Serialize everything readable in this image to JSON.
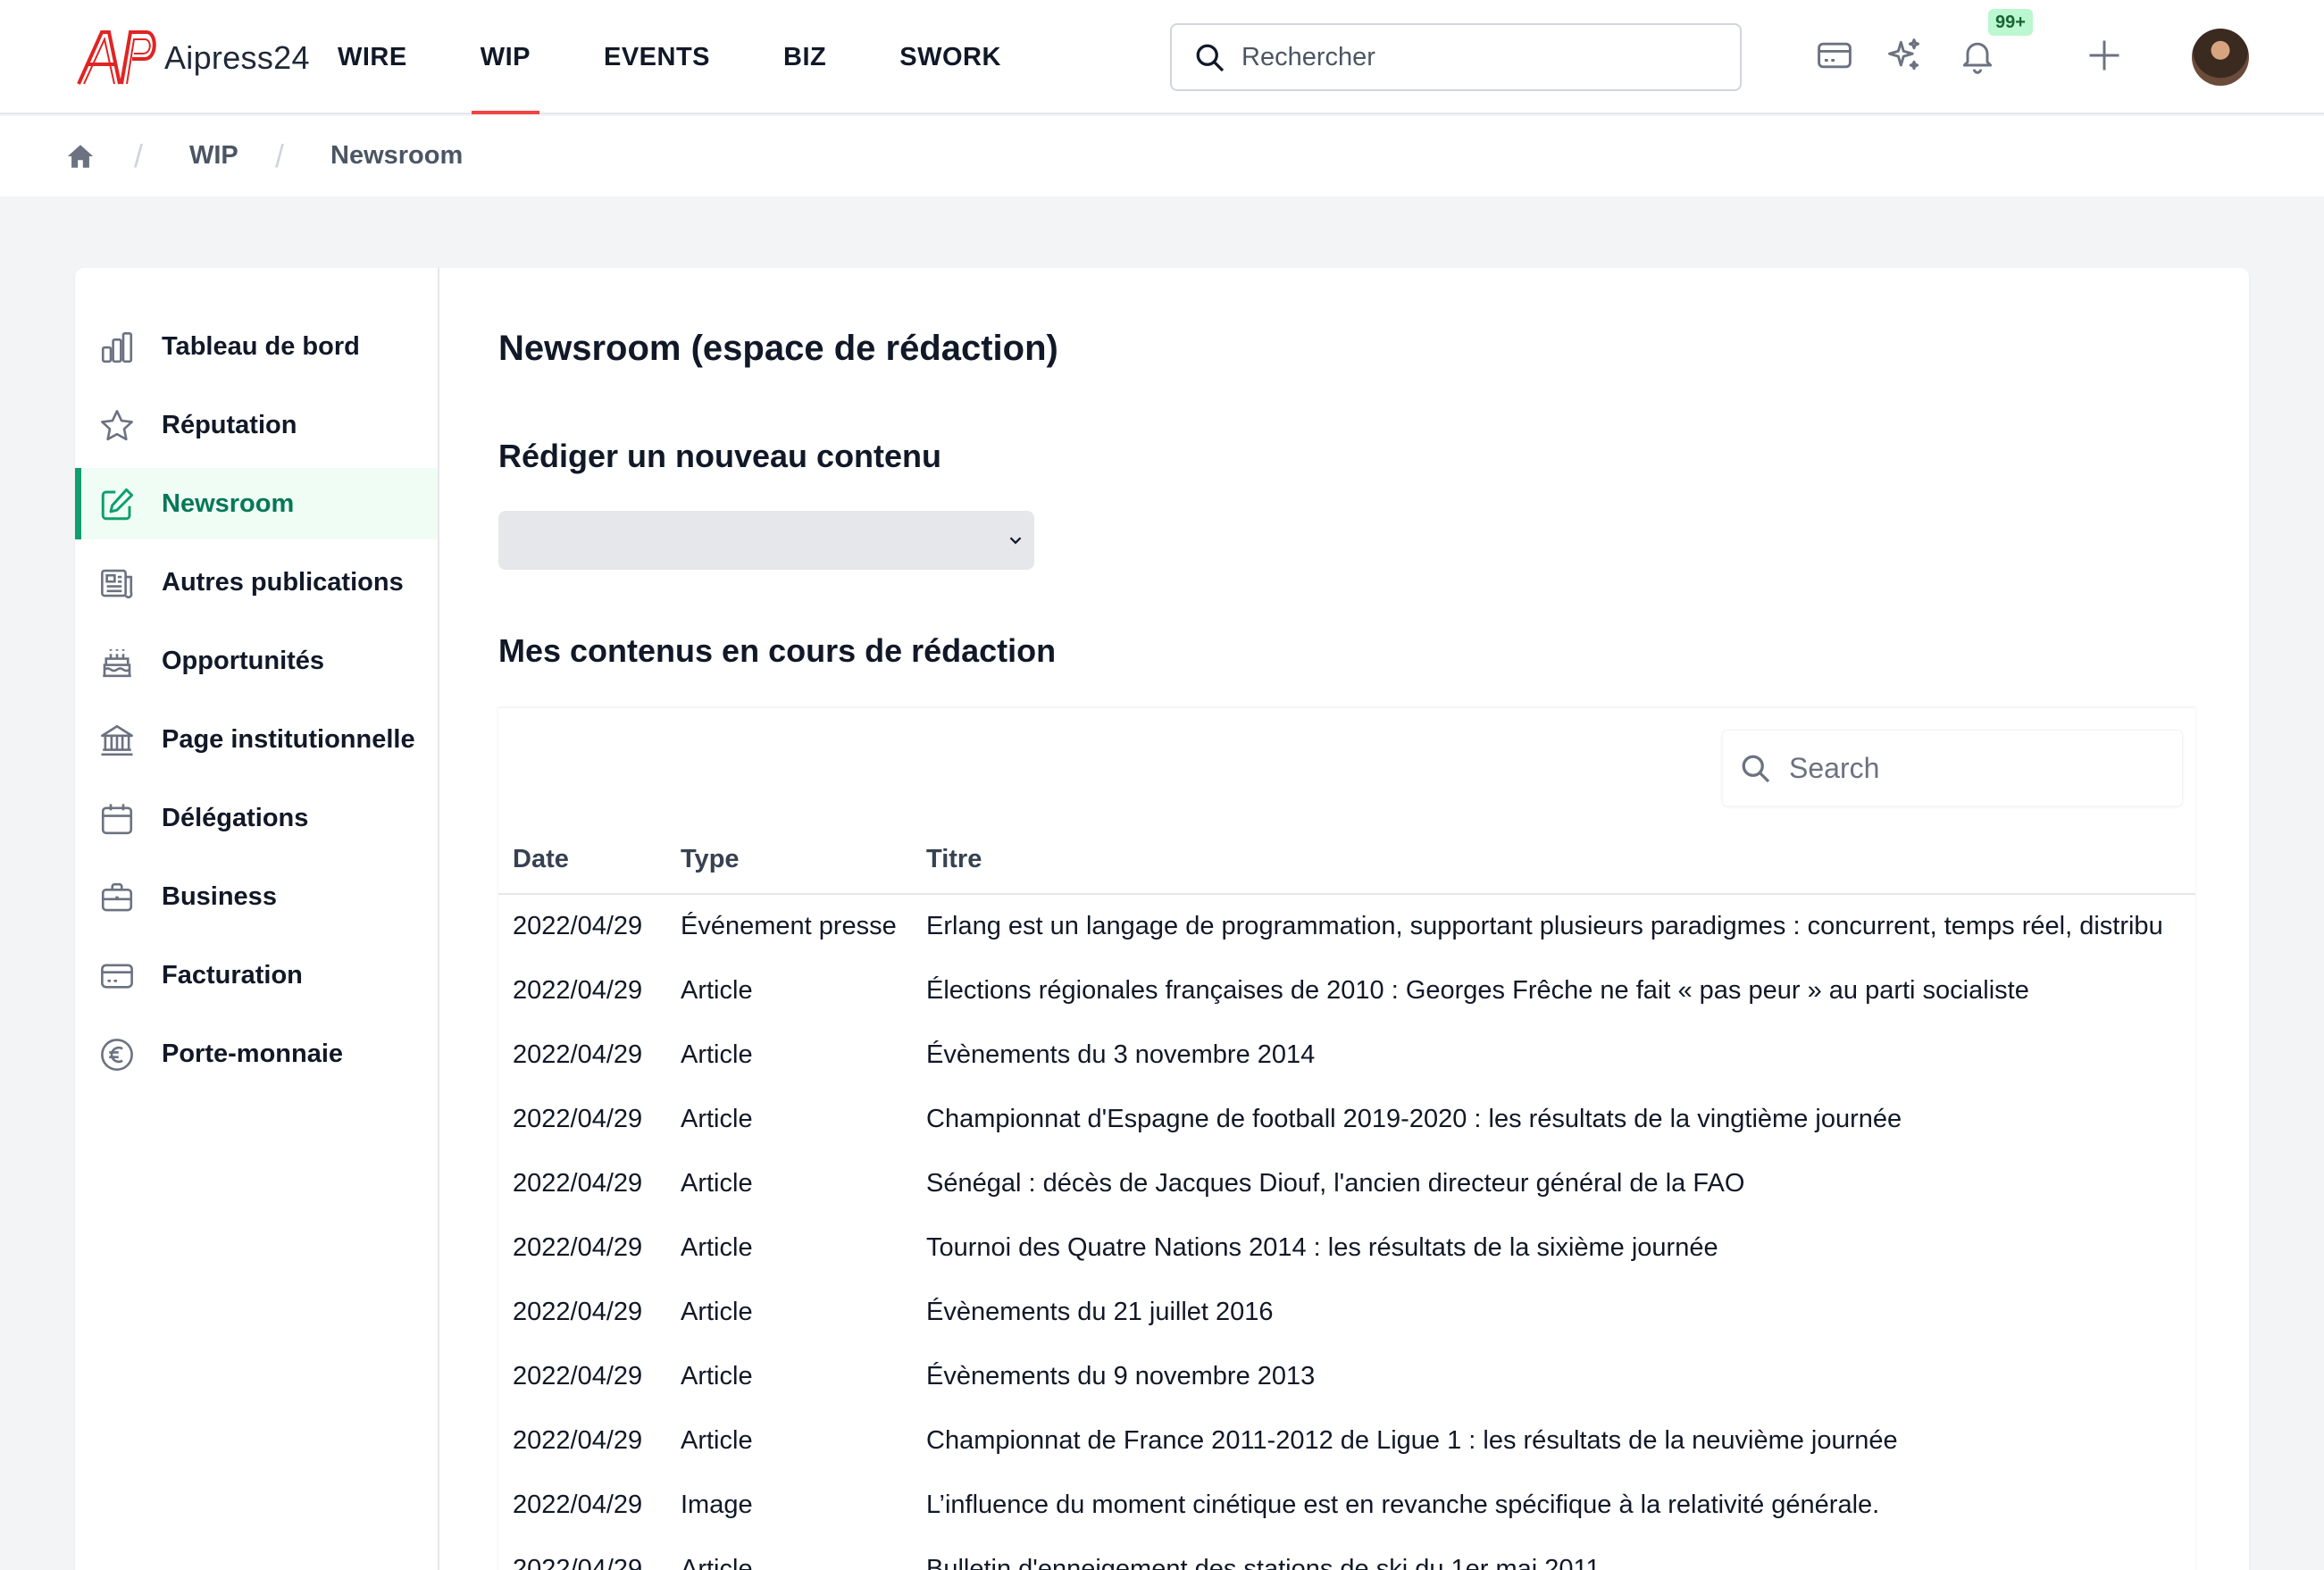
{
  "header": {
    "brand": "Aipress24",
    "nav": [
      {
        "label": "WIRE",
        "active": false
      },
      {
        "label": "WIP",
        "active": true
      },
      {
        "label": "EVENTS",
        "active": false
      },
      {
        "label": "BIZ",
        "active": false
      },
      {
        "label": "SWORK",
        "active": false
      }
    ],
    "search_placeholder": "Rechercher",
    "notification_badge": "99+",
    "icons": [
      "card-icon",
      "sparkles-icon",
      "bell-icon",
      "plus-icon",
      "avatar"
    ]
  },
  "breadcrumb": {
    "items": [
      "WIP",
      "Newsroom"
    ]
  },
  "sidebar": {
    "items": [
      {
        "label": "Tableau de bord",
        "icon": "chart-bar-icon",
        "active": false
      },
      {
        "label": "Réputation",
        "icon": "star-icon",
        "active": false
      },
      {
        "label": "Newsroom",
        "icon": "pencil-square-icon",
        "active": true
      },
      {
        "label": "Autres publications",
        "icon": "newspaper-icon",
        "active": false
      },
      {
        "label": "Opportunités",
        "icon": "cake-icon",
        "active": false
      },
      {
        "label": "Page institutionnelle",
        "icon": "building-library-icon",
        "active": false
      },
      {
        "label": "Délégations",
        "icon": "calendar-icon",
        "active": false
      },
      {
        "label": "Business",
        "icon": "briefcase-icon",
        "active": false
      },
      {
        "label": "Facturation",
        "icon": "credit-card-icon",
        "active": false
      },
      {
        "label": "Porte-monnaie",
        "icon": "euro-icon",
        "active": false
      }
    ]
  },
  "main": {
    "title": "Newsroom (espace de rédaction)",
    "new_content_heading": "Rédiger un nouveau contenu",
    "select_value": "",
    "in_progress_heading": "Mes contenus en cours de rédaction",
    "table_search_placeholder": "Search",
    "table": {
      "columns": [
        "Date",
        "Type",
        "Titre"
      ],
      "rows": [
        [
          "2022/04/29",
          "Événement presse",
          "Erlang est un langage de programmation, supportant plusieurs paradigmes : concurrent, temps réel, distribu"
        ],
        [
          "2022/04/29",
          "Article",
          "Élections régionales françaises de 2010 : Georges Frêche ne fait « pas peur » au parti socialiste"
        ],
        [
          "2022/04/29",
          "Article",
          "Évènements du 3 novembre 2014"
        ],
        [
          "2022/04/29",
          "Article",
          "Championnat d'Espagne de football 2019-2020 : les résultats de la vingtième journée"
        ],
        [
          "2022/04/29",
          "Article",
          "Sénégal : décès de Jacques Diouf, l'ancien directeur général de la FAO"
        ],
        [
          "2022/04/29",
          "Article",
          "Tournoi des Quatre Nations 2014 : les résultats de la sixième journée"
        ],
        [
          "2022/04/29",
          "Article",
          "Évènements du 21 juillet 2016"
        ],
        [
          "2022/04/29",
          "Article",
          "Évènements du 9 novembre 2013"
        ],
        [
          "2022/04/29",
          "Article",
          "Championnat de France 2011-2012 de Ligue 1 : les résultats de la neuvième journée"
        ],
        [
          "2022/04/29",
          "Image",
          "L’influence du moment cinétique est en revanche spécifique à la relativité générale."
        ],
        [
          "2022/04/29",
          "Article",
          "Bulletin d'enneigement des stations de ski du 1er mai 2011"
        ]
      ]
    }
  },
  "colors": {
    "brand_red": "#e02424",
    "nav_active_underline": "#ef4444",
    "sidebar_active": "#047857",
    "badge_bg": "#bbf7d0"
  }
}
